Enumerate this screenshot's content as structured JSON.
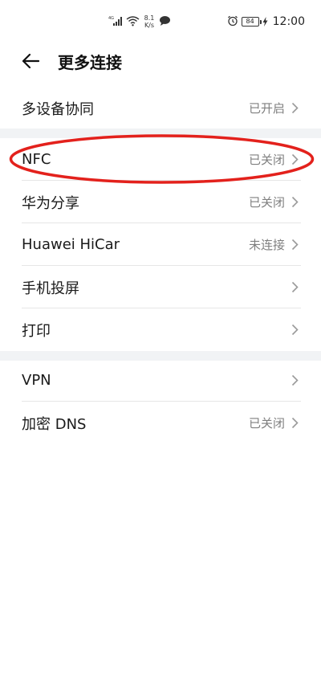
{
  "status_bar": {
    "network_label": "4G",
    "speed_value": "8.1",
    "speed_unit": "K/s",
    "battery": "84",
    "time": "12:00",
    "icons": [
      "signal-icon",
      "wifi-icon",
      "message-bubble-icon",
      "alarm-clock-icon",
      "charging-bolt-icon"
    ]
  },
  "header": {
    "title": "更多连接",
    "back_icon": "back-arrow-icon"
  },
  "groups": [
    {
      "items": [
        {
          "label": "多设备协同",
          "value": "已开启"
        }
      ]
    },
    {
      "items": [
        {
          "label": "NFC",
          "value": "已关闭"
        },
        {
          "label": "华为分享",
          "value": "已关闭"
        },
        {
          "label": "Huawei HiCar",
          "value": "未连接"
        },
        {
          "label": "手机投屏",
          "value": ""
        },
        {
          "label": "打印",
          "value": ""
        }
      ]
    },
    {
      "items": [
        {
          "label": "VPN",
          "value": ""
        },
        {
          "label": "加密 DNS",
          "value": "已关闭"
        }
      ]
    }
  ],
  "colors": {
    "annotation_circle": "#e3211c",
    "group_gap": "#f1f3f5",
    "value_text": "#7f7f7f"
  }
}
